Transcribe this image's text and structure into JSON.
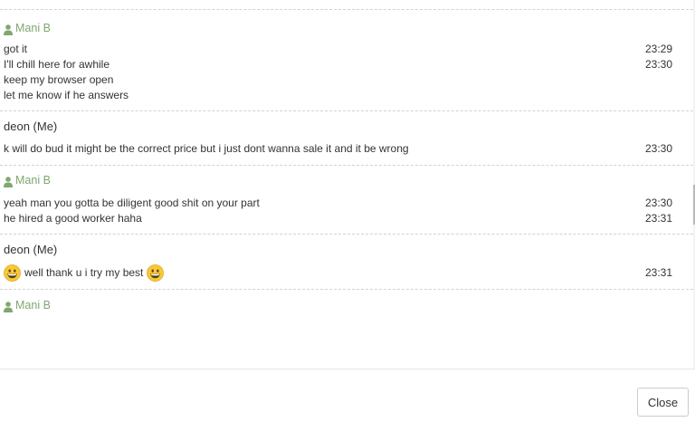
{
  "colors": {
    "other_sender": "#7fa86f",
    "me_sender": "#333333",
    "separator": "#d2d2d2"
  },
  "icons": {
    "sender_icon": "user-icon",
    "emoji": "grinning-face-emoji"
  },
  "messages": [
    {
      "sender": "Mani B",
      "type": "other",
      "lines": [
        {
          "text": "got it",
          "time": "23:29"
        },
        {
          "text": "I'll chill here for awhile",
          "time": "23:30"
        },
        {
          "text": "keep my browser open",
          "time": ""
        },
        {
          "text": "let me know if he answers",
          "time": ""
        }
      ]
    },
    {
      "sender": "deon (Me)",
      "type": "me",
      "lines": [
        {
          "text": "k will do bud it might be the correct price but i just dont wanna sale it and it be wrong",
          "time": "23:30"
        }
      ]
    },
    {
      "sender": "Mani B",
      "type": "other",
      "lines": [
        {
          "text": "yeah man you gotta be diligent good shit on your part",
          "time": "23:30"
        },
        {
          "text": "he hired a good worker haha",
          "time": "23:31"
        }
      ]
    },
    {
      "sender": "deon (Me)",
      "type": "me",
      "lines": [
        {
          "text": "well thank u i try my best",
          "time": "23:31",
          "emoji_before": true,
          "emoji_after": true
        }
      ]
    },
    {
      "sender": "Mani B",
      "type": "other",
      "lines": []
    }
  ],
  "footer": {
    "close_label": "Close"
  }
}
